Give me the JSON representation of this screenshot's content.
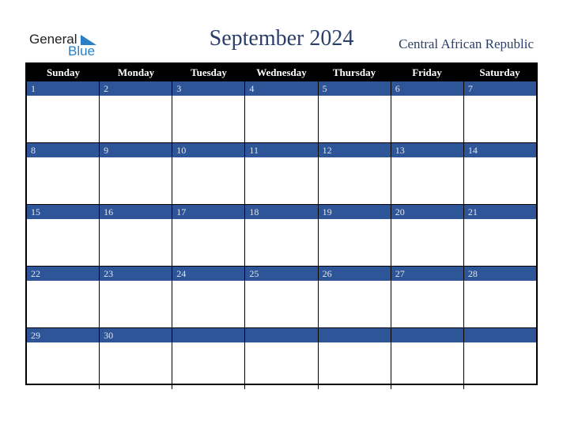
{
  "logo": {
    "general": "General",
    "blue": "Blue"
  },
  "title": "September 2024",
  "country": "Central African Republic",
  "weekdays": [
    "Sunday",
    "Monday",
    "Tuesday",
    "Wednesday",
    "Thursday",
    "Friday",
    "Saturday"
  ],
  "weeks": [
    [
      "1",
      "2",
      "3",
      "4",
      "5",
      "6",
      "7"
    ],
    [
      "8",
      "9",
      "10",
      "11",
      "12",
      "13",
      "14"
    ],
    [
      "15",
      "16",
      "17",
      "18",
      "19",
      "20",
      "21"
    ],
    [
      "22",
      "23",
      "24",
      "25",
      "26",
      "27",
      "28"
    ],
    [
      "29",
      "30",
      "",
      "",
      "",
      "",
      ""
    ]
  ],
  "colors": {
    "date_bar": "#2e5597",
    "header": "#000000",
    "title": "#2b3f6b"
  }
}
